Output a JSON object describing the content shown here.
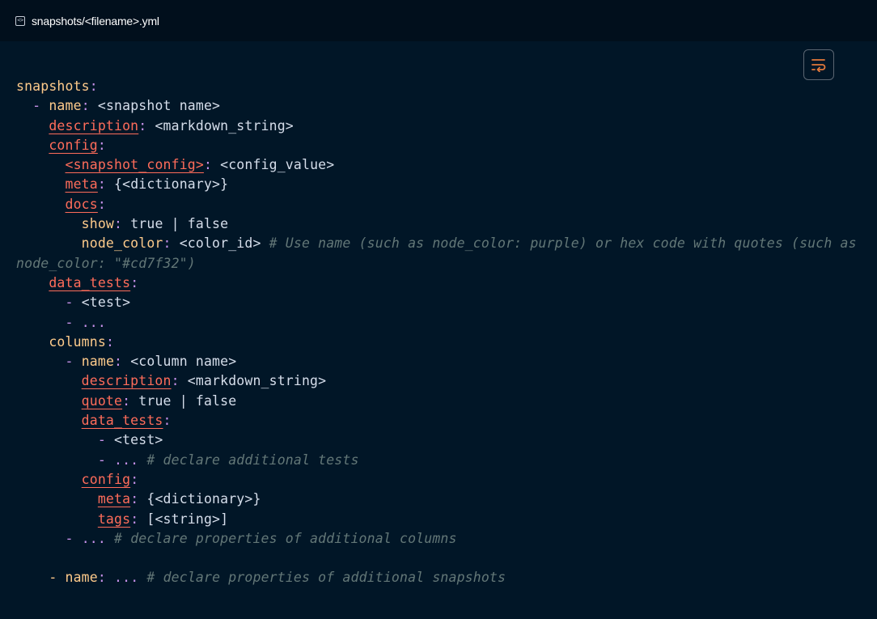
{
  "header": {
    "icon": "code-file-icon",
    "icon_glyph": "<>",
    "filename": "snapshots/<filename>.yml"
  },
  "toolbar": {
    "wrap_icon": "word-wrap-icon",
    "accent_color": "#e2783b"
  },
  "code": {
    "snapshots_key": "snapshots",
    "snapshot_name_key": "name",
    "snapshot_name_value": "<snapshot name>",
    "description_key": "description",
    "description_value": "<markdown_string>",
    "config_key": "config",
    "snapshot_config_key": "<snapshot_config>",
    "snapshot_config_value": "<config_value>",
    "meta_key": "meta",
    "meta_value": "{<dictionary>}",
    "docs_key": "docs",
    "show_key": "show",
    "show_value": "true | false",
    "node_color_key": "node_color",
    "node_color_value": "<color_id>",
    "node_color_comment": "# Use name (such as node_color: purple) or hex code with quotes (such as node_color: \"#cd7f32\")",
    "data_tests_key": "data_tests",
    "test_item": "<test>",
    "ellipsis": "...",
    "columns_key": "columns",
    "column_name_key": "name",
    "column_name_value": "<column name>",
    "column_description_key": "description",
    "column_description_value": "<markdown_string>",
    "quote_key": "quote",
    "quote_value": "true | false",
    "column_data_tests_key": "data_tests",
    "column_test_item": "<test>",
    "additional_tests_comment": "# declare additional tests",
    "column_config_key": "config",
    "column_meta_key": "meta",
    "column_meta_value": "{<dictionary>}",
    "tags_key": "tags",
    "tags_value": "[<string>]",
    "additional_columns_comment": "# declare properties of additional columns",
    "last_name_key": "name",
    "additional_snapshots_comment": "# declare properties of additional snapshots"
  }
}
